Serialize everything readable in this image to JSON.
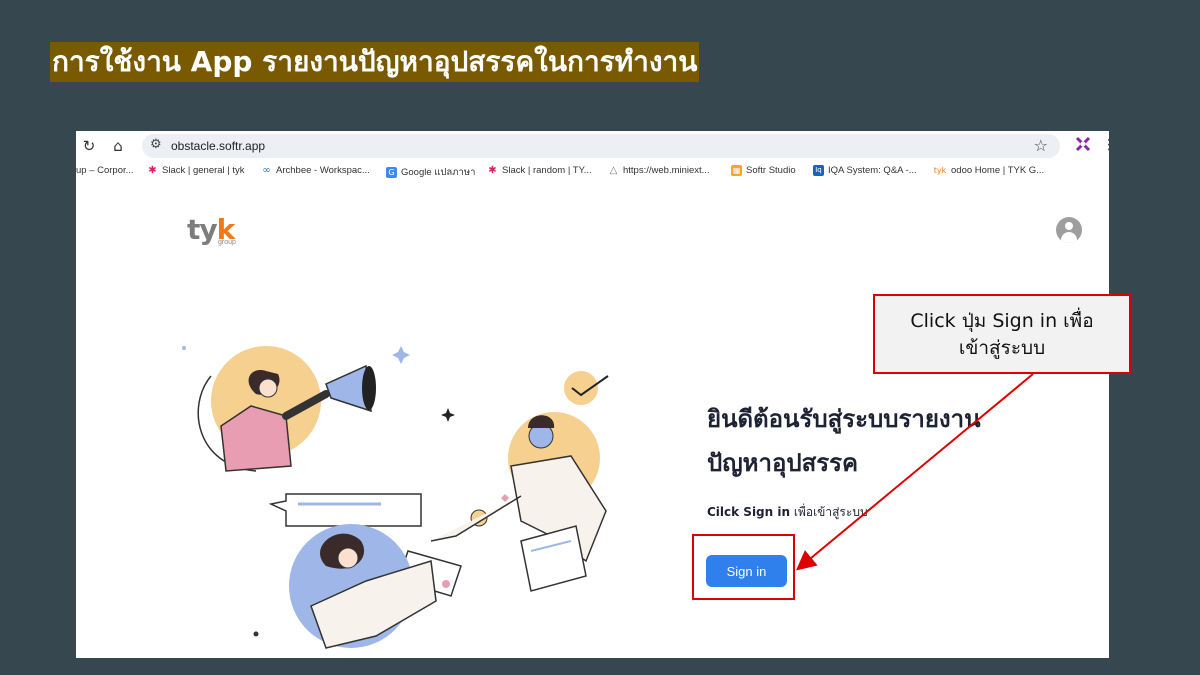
{
  "slide": {
    "title": "การใช้งาน App รายงานปัญหาอุปสรรคในการทำงาน"
  },
  "browser": {
    "url": "obstacle.softr.app",
    "bookmarks": [
      {
        "label": "up – Corpor...",
        "icon": "generic-icon"
      },
      {
        "label": "Slack | general | tyk",
        "icon": "slack-icon"
      },
      {
        "label": "Archbee - Workspac...",
        "icon": "archbee-icon"
      },
      {
        "label": "Google แปลภาษา",
        "icon": "google-translate-icon"
      },
      {
        "label": "Slack | random | TY...",
        "icon": "slack-icon"
      },
      {
        "label": "https://web.miniext...",
        "icon": "miniext-icon"
      },
      {
        "label": "Softr Studio",
        "icon": "softr-icon"
      },
      {
        "label": "IQA System: Q&A -...",
        "icon": "iqa-icon"
      },
      {
        "label": "odoo Home | TYK G...",
        "icon": "tyk-icon"
      }
    ]
  },
  "page": {
    "logo_main": "ty",
    "logo_accent": "k",
    "logo_sub": "group",
    "welcome_line1": "ยินดีต้อนรับสู่ระบบรายงาน",
    "welcome_line2": "ปัญหาอุปสรรค",
    "instruction_bold": "Cilck Sign in",
    "instruction_rest": " เพื่อเข้าสู่ระบบ",
    "signin_label": "Sign in"
  },
  "callout": {
    "line1": "Click ปุ่ม Sign in เพื่อ",
    "line2": "เข้าสู่ระบบ"
  },
  "colors": {
    "slide_bg": "#37474f",
    "title_highlight": "#7a5a00",
    "signin_button": "#2f80ed",
    "annotation_red": "#dd0000"
  }
}
